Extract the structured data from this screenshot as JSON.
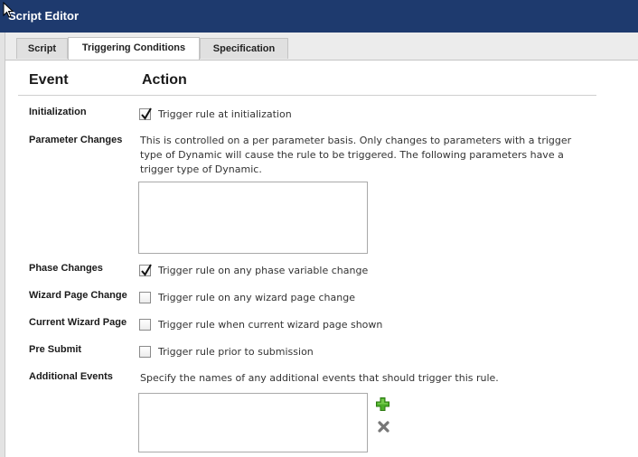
{
  "window": {
    "title": "Script Editor"
  },
  "tabs": [
    {
      "label": "Script"
    },
    {
      "label": "Triggering Conditions"
    },
    {
      "label": "Specification"
    }
  ],
  "active_tab": "Triggering Conditions",
  "columns": {
    "event": "Event",
    "action": "Action"
  },
  "events": {
    "initialization": {
      "label": "Initialization",
      "action": "Trigger rule at initialization",
      "checked": true
    },
    "parameter_changes": {
      "label": "Parameter Changes",
      "description_lines": [
        "This is controlled on a per parameter basis. Only changes to parameters with a trigger",
        "type of Dynamic will cause the rule to be triggered. The following parameters have a",
        "trigger type of Dynamic."
      ]
    },
    "phase_changes": {
      "label": "Phase Changes",
      "action": "Trigger rule on any phase variable change",
      "checked": true
    },
    "wizard_page_change": {
      "label": "Wizard Page Change",
      "action": "Trigger rule on any wizard page change",
      "checked": false
    },
    "current_wizard_page": {
      "label": "Current Wizard Page",
      "action": "Trigger rule when current wizard page shown",
      "checked": false
    },
    "pre_submit": {
      "label": "Pre Submit",
      "action": "Trigger rule prior to submission",
      "checked": false
    },
    "additional_events": {
      "label": "Additional Events",
      "description": "Specify the names of any additional events that should trigger this rule."
    }
  },
  "icons": {
    "add": "plus-icon",
    "remove": "x-icon",
    "check": "checkmark-icon",
    "cursor": "mouse-pointer-icon"
  },
  "colors": {
    "titlebar": "#1e3a6e",
    "add_green": "#4caf2a",
    "remove_gray": "#777777"
  }
}
